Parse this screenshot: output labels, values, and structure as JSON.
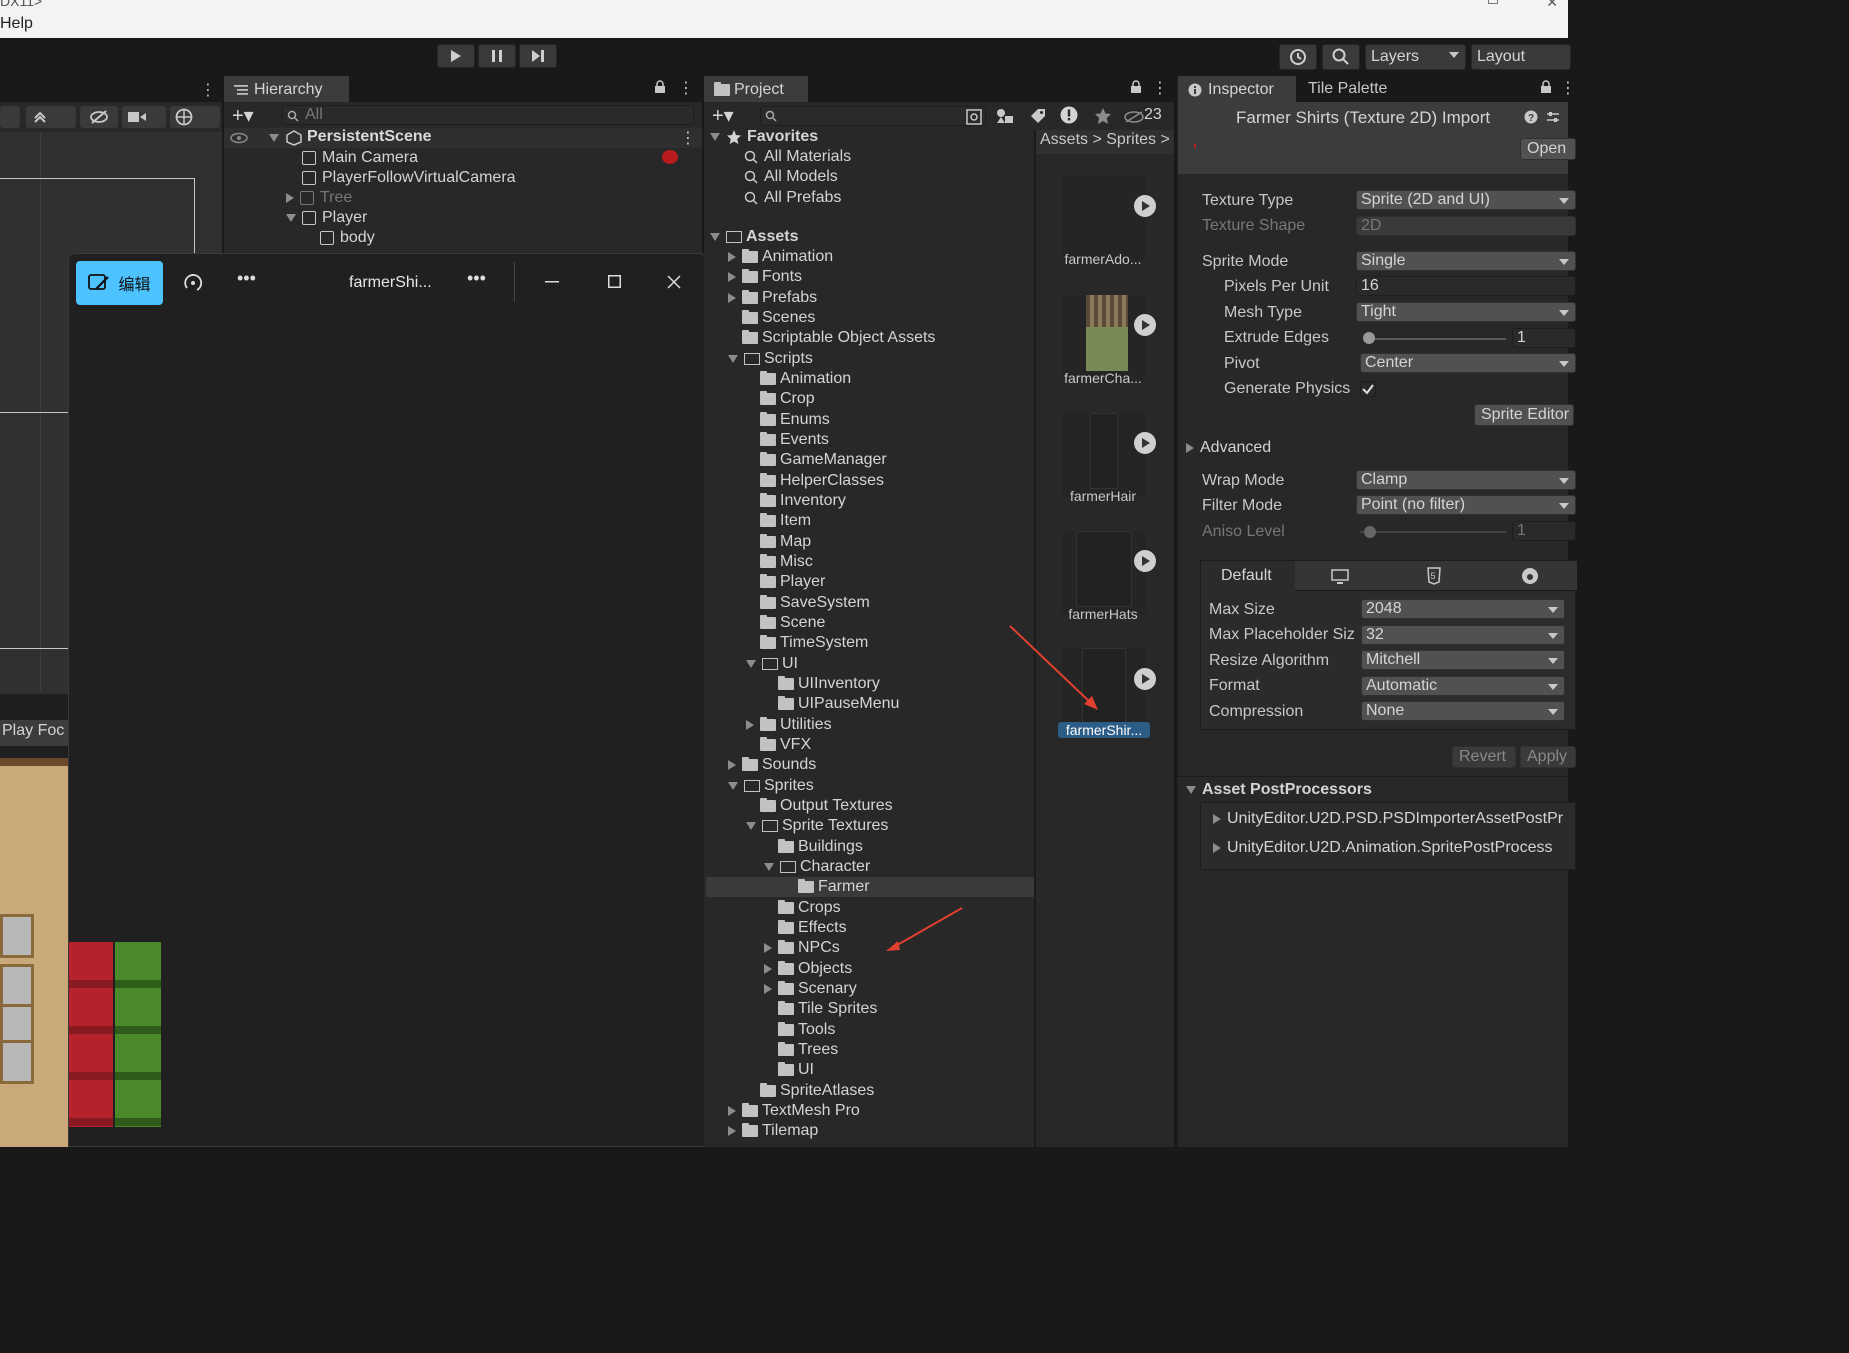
{
  "window": {
    "title_fragment": "DX11>"
  },
  "menu": {
    "help": "Help"
  },
  "toolbar": {
    "layers_label": "Layers",
    "layout_label": "Layout"
  },
  "hierarchy": {
    "tab_label": "Hierarchy",
    "search_placeholder": "All",
    "scene_name": "PersistentScene",
    "items": [
      {
        "label": "Main Camera"
      },
      {
        "label": "PlayerFollowVirtualCamera"
      },
      {
        "label": "Tree"
      },
      {
        "label": "Player"
      },
      {
        "label": "body"
      }
    ]
  },
  "scene_view": {
    "game_tab_fragment": "Play Foc"
  },
  "photo_viewer": {
    "edit_label": "编辑",
    "file_name": "farmerShi...",
    "more": "•••"
  },
  "project": {
    "tab_label": "Project",
    "hidden_count": "23",
    "breadcrumb": {
      "root": "Assets",
      "child": "Sprites"
    },
    "favorites_label": "Favorites",
    "favorites": [
      "All Materials",
      "All Models",
      "All Prefabs"
    ],
    "assets_label": "Assets",
    "tree": [
      {
        "label": "Animation"
      },
      {
        "label": "Fonts"
      },
      {
        "label": "Prefabs"
      },
      {
        "label": "Scenes"
      },
      {
        "label": "Scriptable Object Assets"
      },
      {
        "label": "Scripts"
      },
      {
        "label": "Animation"
      },
      {
        "label": "Crop"
      },
      {
        "label": "Enums"
      },
      {
        "label": "Events"
      },
      {
        "label": "GameManager"
      },
      {
        "label": "HelperClasses"
      },
      {
        "label": "Inventory"
      },
      {
        "label": "Item"
      },
      {
        "label": "Map"
      },
      {
        "label": "Misc"
      },
      {
        "label": "Player"
      },
      {
        "label": "SaveSystem"
      },
      {
        "label": "Scene"
      },
      {
        "label": "TimeSystem"
      },
      {
        "label": "UI"
      },
      {
        "label": "UIInventory"
      },
      {
        "label": "UIPauseMenu"
      },
      {
        "label": "Utilities"
      },
      {
        "label": "VFX"
      },
      {
        "label": "Sounds"
      },
      {
        "label": "Sprites"
      },
      {
        "label": "Output Textures"
      },
      {
        "label": "Sprite Textures"
      },
      {
        "label": "Buildings"
      },
      {
        "label": "Character"
      },
      {
        "label": "Farmer"
      },
      {
        "label": "Crops"
      },
      {
        "label": "Effects"
      },
      {
        "label": "NPCs"
      },
      {
        "label": "Objects"
      },
      {
        "label": "Scenary"
      },
      {
        "label": "Tile Sprites"
      },
      {
        "label": "Tools"
      },
      {
        "label": "Trees"
      },
      {
        "label": "UI"
      },
      {
        "label": "SpriteAtlases"
      },
      {
        "label": "TextMesh Pro"
      },
      {
        "label": "Tilemap"
      }
    ],
    "assets_grid": [
      {
        "label": "farmerAdo..."
      },
      {
        "label": "farmerCha..."
      },
      {
        "label": "farmerHair"
      },
      {
        "label": "farmerHats"
      },
      {
        "label": "farmerShir...",
        "selected": true
      }
    ]
  },
  "inspector": {
    "tab_label": "Inspector",
    "tab2_label": "Tile Palette",
    "header_title": "Farmer Shirts (Texture 2D) Import",
    "open_label": "Open",
    "props": {
      "texture_type": {
        "label": "Texture Type",
        "value": "Sprite (2D and UI)"
      },
      "texture_shape": {
        "label": "Texture Shape",
        "value": "2D"
      },
      "sprite_mode": {
        "label": "Sprite Mode",
        "value": "Single"
      },
      "ppu": {
        "label": "Pixels Per Unit",
        "value": "16"
      },
      "mesh_type": {
        "label": "Mesh Type",
        "value": "Tight"
      },
      "extrude": {
        "label": "Extrude Edges",
        "value": "1"
      },
      "pivot": {
        "label": "Pivot",
        "value": "Center"
      },
      "gen_physics": {
        "label": "Generate Physics",
        "checked": true
      },
      "sprite_editor": "Sprite Editor",
      "advanced": "Advanced",
      "wrap_mode": {
        "label": "Wrap Mode",
        "value": "Clamp"
      },
      "filter_mode": {
        "label": "Filter Mode",
        "value": "Point (no filter)"
      },
      "aniso": {
        "label": "Aniso Level",
        "value": "1"
      }
    },
    "platform": {
      "default_tab": "Default",
      "max_size": {
        "label": "Max Size",
        "value": "2048"
      },
      "max_placeholder": {
        "label": "Max Placeholder Siz",
        "value": "32"
      },
      "resize": {
        "label": "Resize Algorithm",
        "value": "Mitchell"
      },
      "format": {
        "label": "Format",
        "value": "Automatic"
      },
      "compression": {
        "label": "Compression",
        "value": "None"
      }
    },
    "revert": "Revert",
    "apply": "Apply",
    "postprocessors": {
      "title": "Asset PostProcessors",
      "items": [
        "UnityEditor.U2D.PSD.PSDImporterAssetPostPr",
        "UnityEditor.U2D.Animation.SpritePostProcess"
      ]
    }
  },
  "colors": {
    "accent": "#2c5d87",
    "selected_label_bg": "#2c5d87",
    "arrow": "#e0412e",
    "edit_btn": "#4cc2ff"
  }
}
